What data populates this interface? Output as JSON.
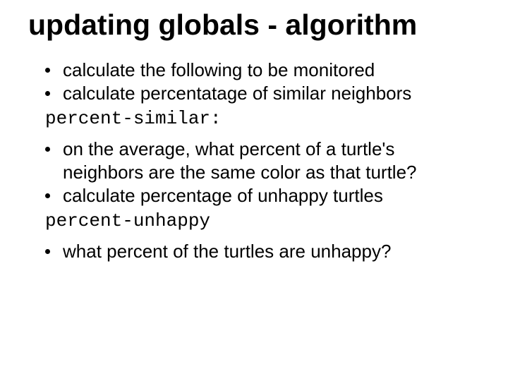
{
  "title": "updating globals - algorithm",
  "items": {
    "b1": "calculate the following to be monitored",
    "b2": "calculate percentatage of similar neighbors",
    "code1": "percent-similar:",
    "b3": "on the average, what percent of a turtle's neighbors are the same color as that turtle?",
    "b4": "calculate percentage of unhappy turtles",
    "code2": "percent-unhappy",
    "b5": "what percent of the turtles are unhappy?"
  }
}
